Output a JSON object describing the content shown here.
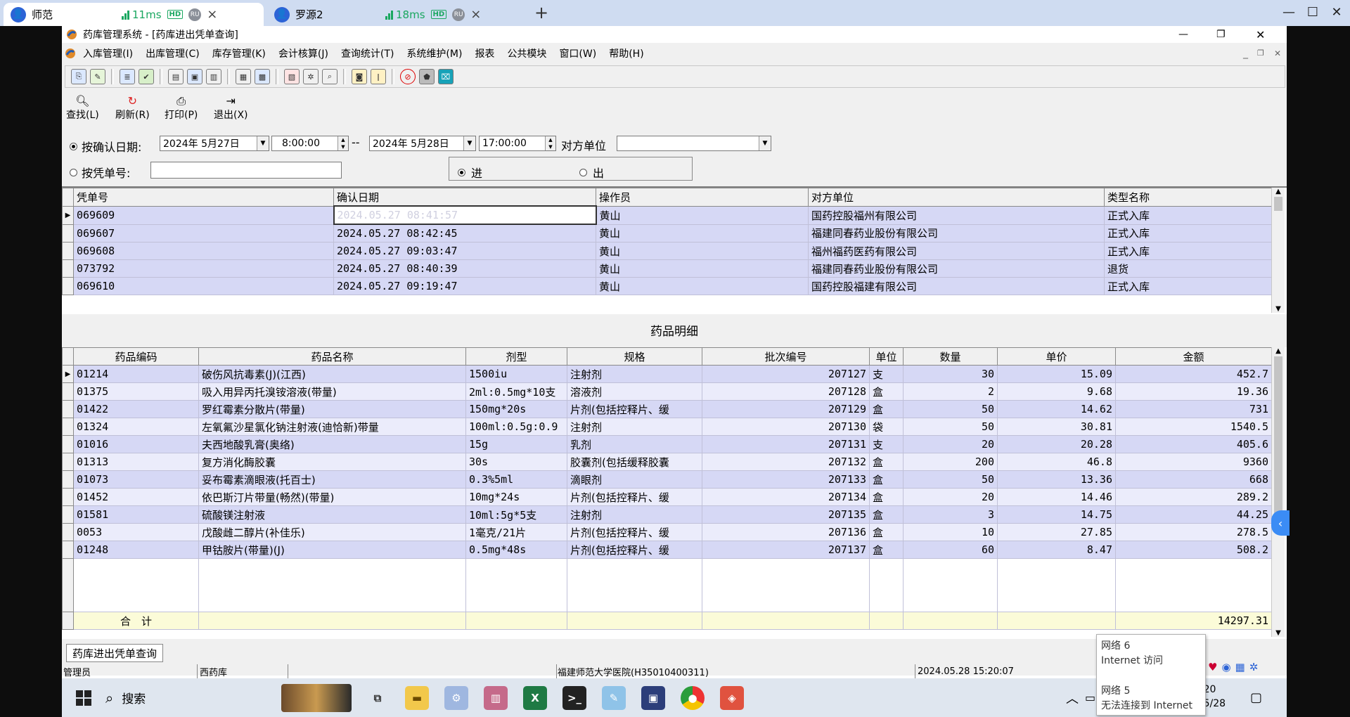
{
  "remote_tabs": [
    {
      "name": "师范",
      "ping": "11ms",
      "hd": "HD",
      "badge": "RU",
      "close": "×"
    },
    {
      "name": "罗源2",
      "ping": "18ms",
      "hd": "HD",
      "badge": "RU",
      "close": "×"
    }
  ],
  "new_tab": "+",
  "window_controls": {
    "minimize": "—",
    "maximize": "☐",
    "close": "✕"
  },
  "app": {
    "title": "药库管理系统 - [药库进出凭单查询]",
    "title_controls": {
      "minimize": "—",
      "restore": "❐",
      "close": "✕"
    },
    "menu": [
      "入库管理(I)",
      "出库管理(C)",
      "库存管理(K)",
      "会计核算(J)",
      "查询统计(T)",
      "系统维护(M)",
      "报表",
      "公共模块",
      "窗口(W)",
      "帮助(H)"
    ],
    "mdi_controls": {
      "minimize": "_",
      "restore": "❐",
      "close": "✕"
    },
    "action_buttons": [
      {
        "label": "查找(L)",
        "icon": "magnifier-icon"
      },
      {
        "label": "刷新(R)",
        "icon": "refresh-icon"
      },
      {
        "label": "打印(P)",
        "icon": "printer-icon"
      },
      {
        "label": "退出(X)",
        "icon": "exit-icon"
      }
    ],
    "filter": {
      "by_date_label": "按确认日期:",
      "date_from": "2024年 5月27日",
      "time_from": "8:00:00",
      "range_sep": "--",
      "date_to": "2024年 5月28日",
      "time_to": "17:00:00",
      "counterparty_label": "对方单位",
      "counterparty_value": "",
      "by_voucher_label": "按凭单号:",
      "voucher_value": "",
      "dir_in": "进",
      "dir_out": "出",
      "by_date_selected": true,
      "direction_selected": "进"
    },
    "voucher_grid": {
      "columns": [
        "凭单号",
        "确认日期",
        "操作员",
        "对方单位",
        "类型名称"
      ],
      "rows": [
        [
          "069609",
          "2024.05.27 08:41:57",
          "黄山",
          "国药控股福州有限公司",
          "正式入库"
        ],
        [
          "069607",
          "2024.05.27 08:42:45",
          "黄山",
          "福建同春药业股份有限公司",
          "正式入库"
        ],
        [
          "069608",
          "2024.05.27 09:03:47",
          "黄山",
          "福州福药医药有限公司",
          "正式入库"
        ],
        [
          "073792",
          "2024.05.27 08:40:39",
          "黄山",
          "福建同春药业股份有限公司",
          "退货"
        ],
        [
          "069610",
          "2024.05.27 09:19:47",
          "黄山",
          "国药控股福建有限公司",
          "正式入库"
        ]
      ]
    },
    "detail_title": "药品明细",
    "detail_grid": {
      "columns": [
        "药品编码",
        "药品名称",
        "剂型",
        "规格",
        "批次编号",
        "单位",
        "数量",
        "单价",
        "金额"
      ],
      "rows": [
        [
          "01214",
          "破伤风抗毒素(J)(江西)",
          "1500iu",
          "注射剂",
          "207127",
          "支",
          "30",
          "15.09",
          "452.7"
        ],
        [
          "01375",
          "吸入用异丙托溴铵溶液(带量)",
          "2ml:0.5mg*10支",
          "溶液剂",
          "207128",
          "盒",
          "2",
          "9.68",
          "19.36"
        ],
        [
          "01422",
          "罗红霉素分散片(带量)",
          "150mg*20s",
          "片剂(包括控释片、缓",
          "207129",
          "盒",
          "50",
          "14.62",
          "731"
        ],
        [
          "01324",
          "左氧氟沙星氯化钠注射液(迪恰新)带量",
          "100ml:0.5g:0.9",
          "注射剂",
          "207130",
          "袋",
          "50",
          "30.81",
          "1540.5"
        ],
        [
          "01016",
          "夫西地酸乳膏(奥络)",
          "15g",
          "乳剂",
          "207131",
          "支",
          "20",
          "20.28",
          "405.6"
        ],
        [
          "01313",
          "复方消化酶胶囊",
          "30s",
          "胶囊剂(包括缓释胶囊",
          "207132",
          "盒",
          "200",
          "46.8",
          "9360"
        ],
        [
          "01073",
          "妥布霉素滴眼液(托百士)",
          "0.3%5ml",
          "滴眼剂",
          "207133",
          "盒",
          "50",
          "13.36",
          "668"
        ],
        [
          "01452",
          "依巴斯汀片带量(畅然)(带量)",
          "10mg*24s",
          "片剂(包括控释片、缓",
          "207134",
          "盒",
          "20",
          "14.46",
          "289.2"
        ],
        [
          "01581",
          "硫酸镁注射液",
          "10ml:5g*5支",
          "注射剂",
          "207135",
          "盒",
          "3",
          "14.75",
          "44.25"
        ],
        [
          "0053",
          "戊酸雌二醇片(补佳乐)",
          "1毫克/21片",
          "片剂(包括控释片、缓",
          "207136",
          "盒",
          "10",
          "27.85",
          "278.5"
        ],
        [
          "01248",
          "甲钴胺片(带量)(J)",
          "0.5mg*48s",
          "片剂(包括控释片、缓",
          "207137",
          "盒",
          "60",
          "8.47",
          "508.2"
        ]
      ],
      "total_label": "合　计",
      "total_amount": "14297.31"
    },
    "bottom_tab": "药库进出凭单查询",
    "status": {
      "user": "管理员",
      "store": "西药库",
      "hospital": "福建师范大学医院(H35010400311)",
      "datetime": "2024.05.28 15:20:07"
    }
  },
  "taskbar": {
    "search": "搜索",
    "time": "5:20",
    "date": "4/5/28"
  },
  "network_popup": {
    "net1_name": "网络 6",
    "net1_status": "Internet 访问",
    "net2_name": "网络 5",
    "net2_status": "无法连接到 Internet"
  },
  "colors": {
    "row_dark": "#d6d8f5",
    "row_light": "#ebecfb",
    "total_row": "#fbfbd8",
    "ping_green": "#1aa760",
    "remote_bar": "#cfdcf1"
  }
}
